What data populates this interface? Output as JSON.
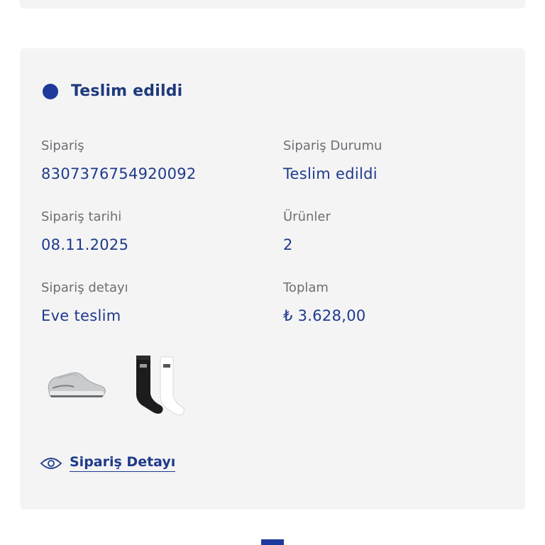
{
  "order": {
    "status_title": "Teslim edildi",
    "fields": {
      "order_label": "Sipariş",
      "order_value": "8307376754920092",
      "status_label": "Sipariş Durumu",
      "status_value": "Teslim edildi",
      "date_label": "Sipariş tarihi",
      "date_value": "08.11.2025",
      "items_label": "Ürünler",
      "items_value": "2",
      "detail_label": "Sipariş detayı",
      "detail_value": "Eve teslim",
      "total_label": "Toplam",
      "total_value": "₺ 3.628,00"
    },
    "products": [
      {
        "icon": "sneaker-icon"
      },
      {
        "icon": "socks-icon"
      }
    ],
    "detail_link": "Sipariş Detayı"
  },
  "colors": {
    "accent": "#1e3a9c",
    "value_text": "#1e3a8a",
    "label_text": "#6e6e73",
    "card_bg": "#f4f4f5"
  }
}
